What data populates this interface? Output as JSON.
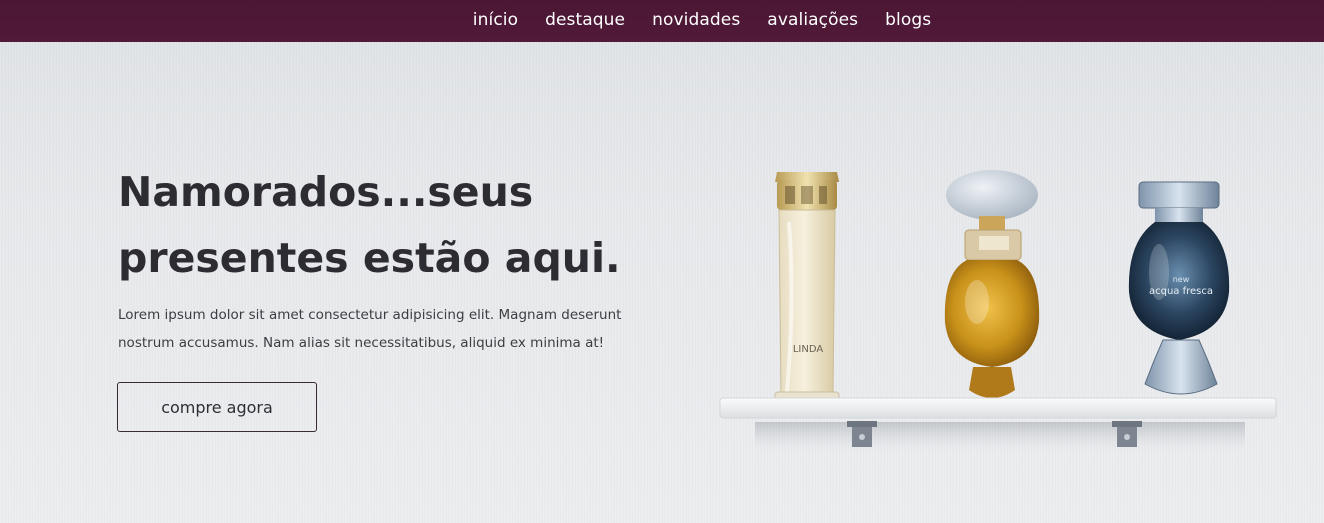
{
  "nav": {
    "items": [
      {
        "label": "início"
      },
      {
        "label": "destaque"
      },
      {
        "label": "novidades"
      },
      {
        "label": "avaliações"
      },
      {
        "label": "blogs"
      }
    ]
  },
  "hero": {
    "title_line1": "Namorados...seus",
    "title_line2": "presentes estão aqui.",
    "description_line1": "Lorem ipsum dolor sit amet consectetur adipisicing elit. Magnam deserunt",
    "description_line2": "nostrum accusamus. Nam alias sit necessitatibus, aliquid ex minima at!",
    "cta_label": "compre agora"
  },
  "products": {
    "bottle1_label": "LINDA",
    "bottle3_label_top": "new",
    "bottle3_label_main": "acqua fresca"
  },
  "colors": {
    "nav_background": "#4e1836",
    "heading_text": "#2c2c32"
  }
}
